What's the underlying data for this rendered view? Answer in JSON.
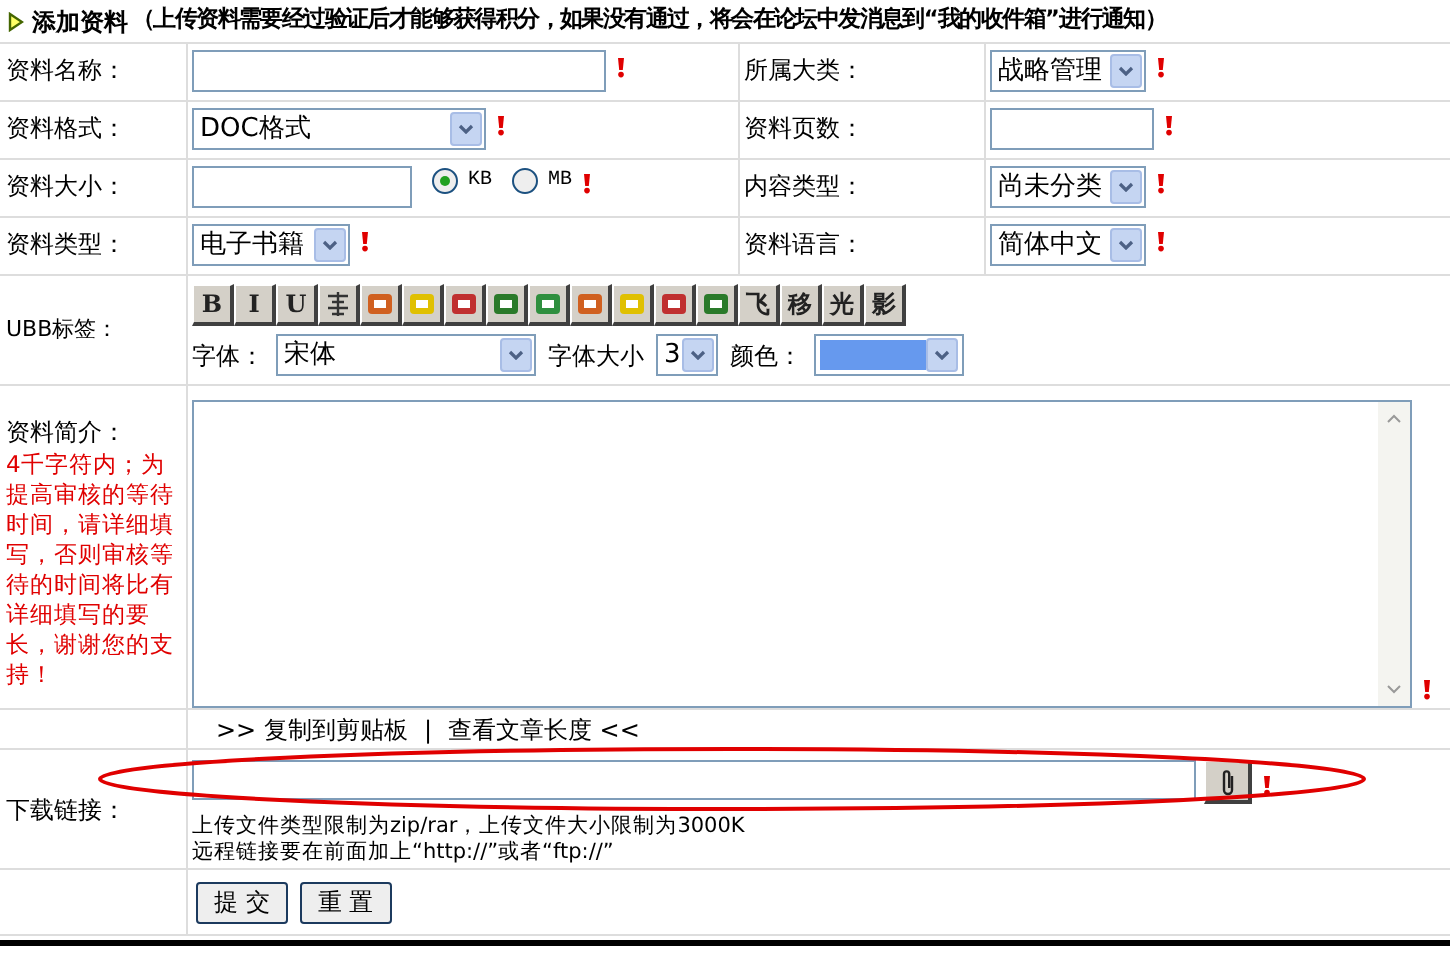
{
  "header": {
    "title": "添加资料",
    "note": "（上传资料需要经过验证后才能够获得积分，如果没有通过，将会在论坛中发消息到“我的收件箱”进行通知）"
  },
  "rows": [
    {
      "left": {
        "label": "资料名称：",
        "kind": "input",
        "required": true
      },
      "right": {
        "label": "所属大类：",
        "kind": "select",
        "value": "战略管理",
        "required": true
      }
    },
    {
      "left": {
        "label": "资料格式：",
        "kind": "select",
        "value": "DOC格式",
        "required": true
      },
      "right": {
        "label": "资料页数：",
        "kind": "input",
        "required": true
      }
    },
    {
      "left": {
        "label": "资料大小：",
        "kind": "size",
        "required": true,
        "units": [
          {
            "label": "KB",
            "selected": true
          },
          {
            "label": "MB",
            "selected": false
          }
        ]
      },
      "right": {
        "label": "内容类型：",
        "kind": "select",
        "value": "尚未分类",
        "required": true
      }
    },
    {
      "left": {
        "label": "资料类型：",
        "kind": "select",
        "value": "电子书籍",
        "required": true
      },
      "right": {
        "label": "资料语言：",
        "kind": "select",
        "value": "简体中文",
        "required": true
      }
    }
  ],
  "ubb": {
    "label": "UBB标签：",
    "buttons": [
      {
        "kind": "text",
        "text": "B"
      },
      {
        "kind": "text",
        "text": "I"
      },
      {
        "kind": "text",
        "text": "U"
      },
      {
        "kind": "icon"
      },
      {
        "kind": "icon"
      },
      {
        "kind": "icon"
      },
      {
        "kind": "icon"
      },
      {
        "kind": "icon"
      },
      {
        "kind": "icon"
      },
      {
        "kind": "icon"
      },
      {
        "kind": "icon"
      },
      {
        "kind": "icon"
      },
      {
        "kind": "icon"
      },
      {
        "kind": "text",
        "text": "飞"
      },
      {
        "kind": "text",
        "text": "移"
      },
      {
        "kind": "text",
        "text": "光"
      },
      {
        "kind": "text",
        "text": "影"
      }
    ],
    "font_label": "字体：",
    "font_value": "宋体",
    "size_label": "字体大小",
    "size_value": "3",
    "color_label": "颜色："
  },
  "description": {
    "label": "资料简介：",
    "hint": "4千字符内；为提高审核的等待时间，请详细填写，否则审核等待的时间将比有详细填写的要长，谢谢您的支持！",
    "required": true
  },
  "tools": {
    "copy": ">> 复制到剪贴板",
    "separator": "|",
    "length": "查看文章长度 <<"
  },
  "download": {
    "label": "下载链接：",
    "required": true,
    "note_1": "上传文件类型限制为zip/rar，上传文件大小限制为3000K",
    "note_2": "远程链接要在前面加上“http://”或者“ftp://”"
  },
  "buttons": [
    "提 交",
    "重 置"
  ]
}
